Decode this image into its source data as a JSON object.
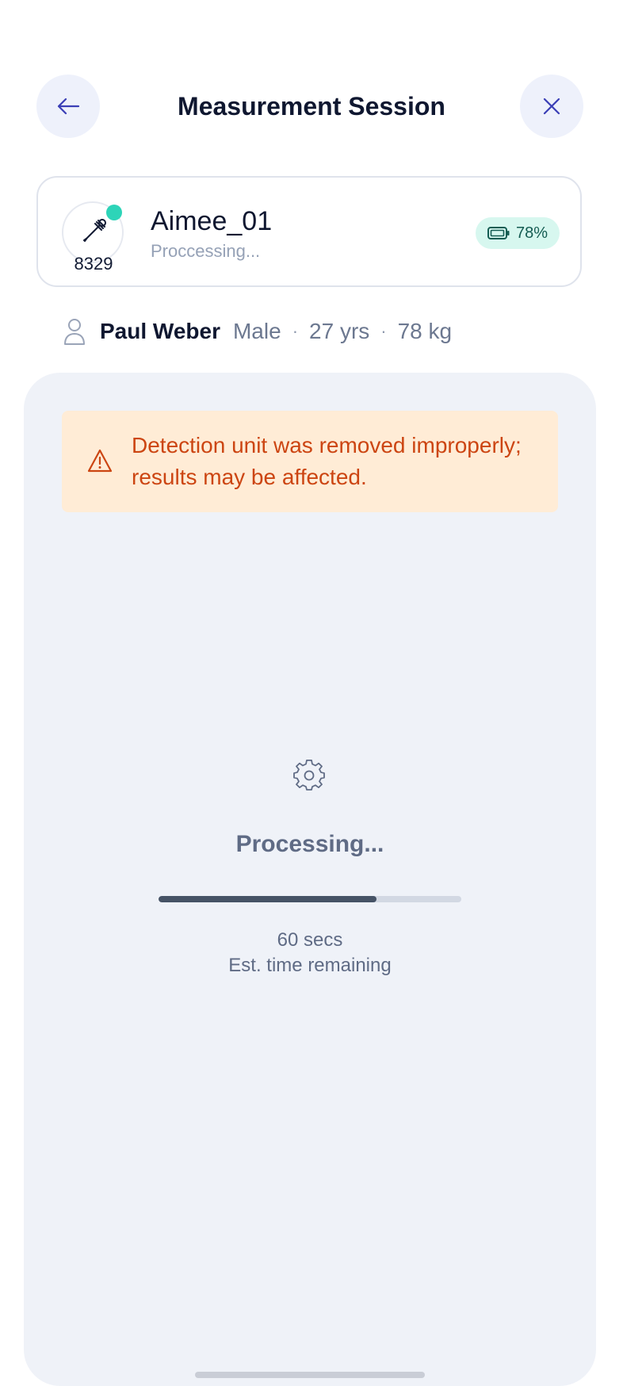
{
  "header": {
    "title": "Measurement Session",
    "back_icon": "arrow-left-icon",
    "close_icon": "close-icon"
  },
  "device": {
    "name": "Aimee_01",
    "status": "Proccessing...",
    "id": "8329",
    "icon": "dropper-icon",
    "online_color": "#2dd4b8",
    "battery": "78%"
  },
  "patient": {
    "name": "Paul Weber",
    "sex": "Male",
    "age": "27 yrs",
    "weight": "78 kg",
    "separator": "·"
  },
  "alert": {
    "message": "Detection unit was removed improperly; results may be affected.",
    "icon": "warning-icon",
    "color": "#cc4512"
  },
  "processing": {
    "label": "Processing...",
    "progress_fraction": 0.72,
    "time_value": "60 secs",
    "time_caption": "Est. time remaining",
    "icon": "gear-icon"
  },
  "colors": {
    "accent": "#3b3fb6",
    "panel_bg": "#eff2f8",
    "alert_bg": "#ffecd6"
  }
}
